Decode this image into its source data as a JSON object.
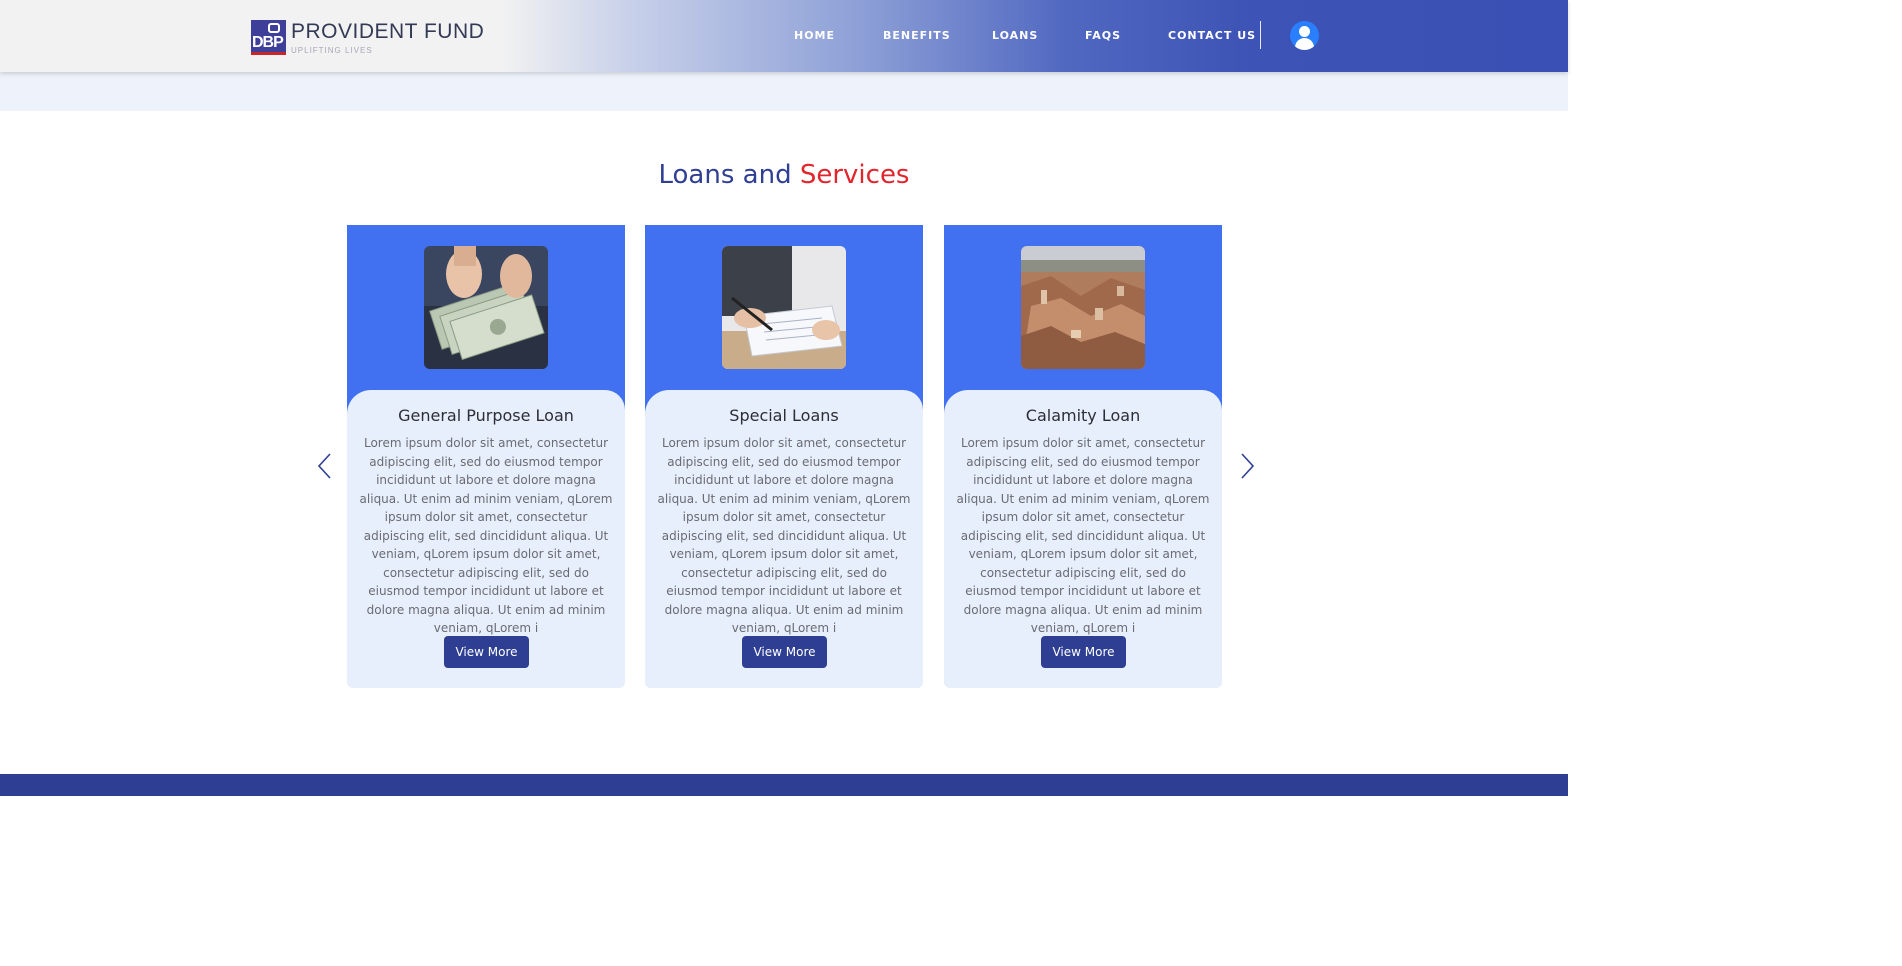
{
  "header": {
    "logo": {
      "badge": "DBP",
      "title": "PROVIDENT FUND",
      "tagline": "UPLIFTING LIVES"
    },
    "nav": [
      {
        "label": "HOME"
      },
      {
        "label": "BENEFITS"
      },
      {
        "label": "LOANS"
      },
      {
        "label": "FAQS"
      },
      {
        "label": "CONTACT US"
      }
    ],
    "account_icon": "user-icon"
  },
  "section": {
    "title_part1": "Loans and",
    "title_part2": "Services",
    "prev_icon": "chevron-left-icon",
    "next_icon": "chevron-right-icon"
  },
  "cards": [
    {
      "title": "General Purpose Loan",
      "image": "cash-money-photo",
      "body": "Lorem ipsum dolor sit amet, consectetur adipiscing elit, sed do eiusmod tempor incididunt ut labore et dolore magna aliqua. Ut enim ad minim veniam, qLorem ipsum dolor sit amet, consectetur adipiscing elit, sed dincididunt aliqua. Ut veniam, qLorem ipsum dolor sit amet, consectetur adipiscing elit, sed do eiusmod tempor incididunt ut labore et dolore magna aliqua. Ut enim ad minim veniam, qLorem i",
      "button": "View More"
    },
    {
      "title": "Special Loans",
      "image": "signing-document-photo",
      "body": "Lorem ipsum dolor sit amet, consectetur adipiscing elit, sed do eiusmod tempor incididunt ut labore et dolore magna aliqua. Ut enim ad minim veniam, qLorem ipsum dolor sit amet, consectetur adipiscing elit, sed dincididunt aliqua. Ut veniam, qLorem ipsum dolor sit amet, consectetur adipiscing elit, sed do eiusmod tempor incididunt ut labore et dolore magna aliqua. Ut enim ad minim veniam, qLorem i",
      "button": "View More"
    },
    {
      "title": "Calamity Loan",
      "image": "disaster-rubble-photo",
      "body": "Lorem ipsum dolor sit amet, consectetur adipiscing elit, sed do eiusmod tempor incididunt ut labore et dolore magna aliqua. Ut enim ad minim veniam, qLorem ipsum dolor sit amet, consectetur adipiscing elit, sed dincididunt aliqua. Ut veniam, qLorem ipsum dolor sit amet, consectetur adipiscing elit, sed do eiusmod tempor incididunt ut labore et dolore magna aliqua. Ut enim ad minim veniam, qLorem i",
      "button": "View More"
    }
  ],
  "colors": {
    "brand_blue": "#2e3f93",
    "accent_red": "#e0262c",
    "card_top": "#4171f0",
    "card_bg": "#e7effd"
  }
}
